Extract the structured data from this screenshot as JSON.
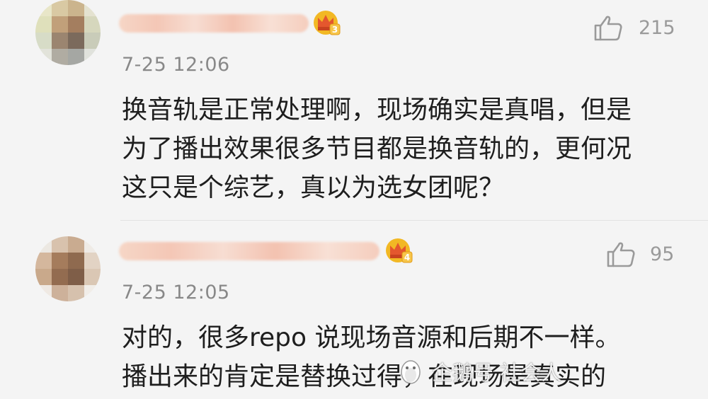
{
  "comments": [
    {
      "timestamp": "7-25 12:06",
      "likes": "215",
      "level": "3",
      "lines": [
        "换音轨是正常处理啊，现场确实是真唱，但是",
        "为了播出效果很多节目都是换音轨的，更何况",
        "这只是个综艺，真以为选女团呢？"
      ]
    },
    {
      "timestamp": "7-25 12:05",
      "likes": "95",
      "level": "4",
      "lines": [
        "对的，很多repo 说现场音源和后期不一样。",
        "播出来的肯定是替换过得，在现场是真实的"
      ]
    }
  ],
  "watermark": {
    "text": "企鹅号 社会人"
  },
  "colors": {
    "badge_gold": "#f2b824",
    "badge_red": "#e4572e",
    "text": "#1e1e1e",
    "meta": "#888888"
  },
  "icons": {
    "like": "thumbs-up-icon",
    "badge": "crown-level-icon",
    "logo": "penguin-logo-icon"
  }
}
